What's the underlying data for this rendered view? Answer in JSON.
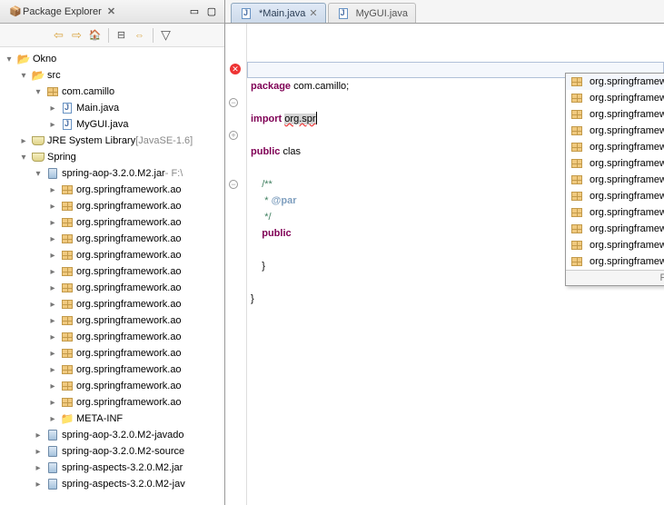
{
  "packageexplorer": {
    "title": "Package Explorer",
    "close": "✕",
    "project": "Okno",
    "src": "src",
    "package": "com.camillo",
    "main": "Main.java",
    "mygui": "MyGUI.java",
    "jre": "JRE System Library",
    "jre_suffix": " [JavaSE-1.6]",
    "spring": "Spring",
    "springaop": "spring-aop-3.2.0.M2.jar",
    "springaop_suffix": " - F:\\",
    "pkgs": [
      "org.springframework.ao",
      "org.springframework.ao",
      "org.springframework.ao",
      "org.springframework.ao",
      "org.springframework.ao",
      "org.springframework.ao",
      "org.springframework.ao",
      "org.springframework.ao",
      "org.springframework.ao",
      "org.springframework.ao",
      "org.springframework.ao",
      "org.springframework.ao",
      "org.springframework.ao",
      "org.springframework.ao"
    ],
    "metainf": "META-INF",
    "jars": [
      "spring-aop-3.2.0.M2-javado",
      "spring-aop-3.2.0.M2-source",
      "spring-aspects-3.2.0.M2.jar",
      "spring-aspects-3.2.0.M2-jav"
    ]
  },
  "tabs": {
    "tab1": "*Main.java",
    "tab2": "MyGUI.java"
  },
  "code": {
    "l1_package": "package",
    "l1_rest": " com.camillo;",
    "l3_import": "import",
    "l3_rest": " ",
    "l3_org": "org.spr",
    "l5_public": "public",
    "l5_rest": " clas",
    "l7": "    /**",
    "l8": "     * @par",
    "l9": "     */",
    "l10_public": "    public",
    "l12": "    }",
    "l14": "}"
  },
  "popup": {
    "items": [
      "org.springframework.*;",
      "org.springframework.aop.*;",
      "org.springframework.aop.aspectj.*;",
      "org.springframework.aop.aspectj.annotation.*;",
      "org.springframework.aop.aspectj.autoproxy.*;",
      "org.springframework.aop.config.*;",
      "org.springframework.aop.framework.*;",
      "org.springframework.aop.framework.adapter.*;",
      "org.springframework.aop.framework.autoproxy.*;",
      "org.springframework.aop.framework.autoproxy.target.*;",
      "org.springframework.aop.interceptor.*;",
      "org.springframework.aop.scope.*;"
    ],
    "hint": "Press 'Ctrl+Space' to show Template Proposals"
  }
}
